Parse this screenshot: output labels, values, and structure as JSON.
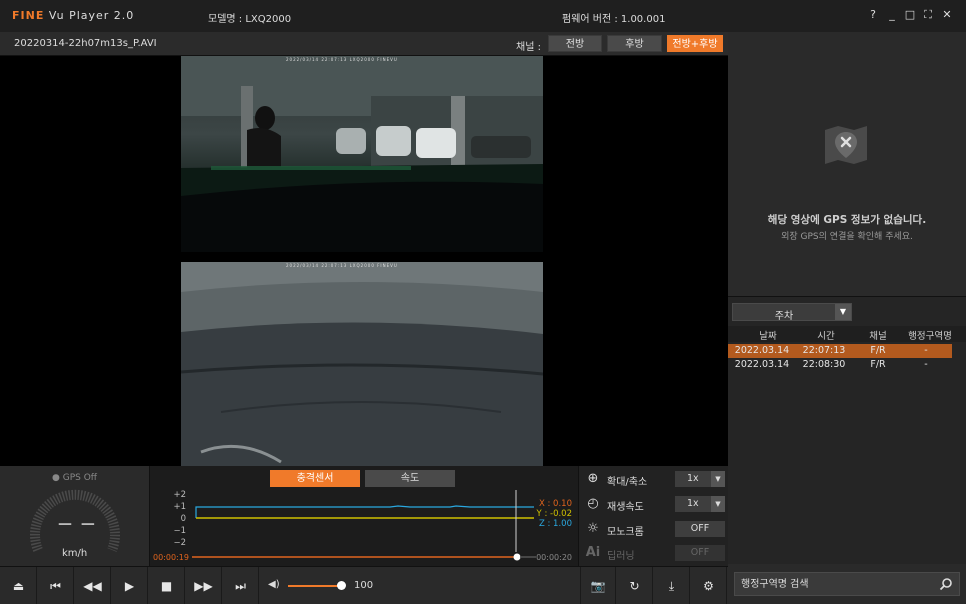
{
  "titlebar": {
    "logo_brand": "FINE",
    "logo_vu": "Vu",
    "logo_name": "Player 2.0",
    "model": "모델명 : LXQ2000",
    "firmware": "펌웨어 버전 : 1.00.001",
    "help": "?",
    "minimize": "_",
    "maximize": "□",
    "fullscreen": "⛶",
    "close": "✕"
  },
  "filebar": {
    "filename": "20220314-22h07m13s_P.AVI",
    "channel_label": "채널 :",
    "channels": [
      "전방",
      "후방",
      "전방+후방"
    ],
    "active_channel": "전방+후방"
  },
  "gps": {
    "message": "해당 영상에 GPS 정보가 없습니다.",
    "sub_message": "외장 GPS의 연결을 확인해 주세요."
  },
  "events": {
    "filter": "주차",
    "headers": [
      "날짜",
      "시간",
      "채널",
      "행정구역명"
    ],
    "rows": [
      {
        "date": "2022.03.14",
        "time": "22:07:13",
        "channel": "F/R",
        "region": "-"
      },
      {
        "date": "2022.03.14",
        "time": "22:08:30",
        "channel": "F/R",
        "region": "-"
      }
    ]
  },
  "gauge": {
    "gps_status": "● GPS Off",
    "speed": "— —",
    "unit": "km/h"
  },
  "graph": {
    "tabs": [
      "충격센서",
      "속도"
    ],
    "active_tab": "충격센서",
    "y_labels": [
      "+2",
      "+1",
      "0",
      "−1",
      "−2"
    ],
    "x_label": "X : 0.10",
    "y_label": "Y : -0.02",
    "z_label": "Z : 1.00",
    "time_start": "00:00:19",
    "time_end": "00:00:20",
    "colors": {
      "x": "#e0641e",
      "y": "#cfc000",
      "z": "#2aa8e0"
    }
  },
  "options": {
    "zoom_label": "확대/축소",
    "zoom_value": "1x",
    "speed_label": "재생속도",
    "speed_value": "1x",
    "mono_label": "모노크롬",
    "mono_value": "OFF",
    "ai_label": "딥러닝",
    "ai_value": "OFF"
  },
  "controls": {
    "volume": "100",
    "playback_progress": 0.98,
    "volume_level": 1.0
  },
  "search": {
    "placeholder": "행정구역명 검색"
  },
  "osd": {
    "front": "2022/03/14 22:07:13  LXQ2000  FINEVU",
    "rear": "2022/03/14 22:07:13  LXQ2000  FINEVU"
  }
}
